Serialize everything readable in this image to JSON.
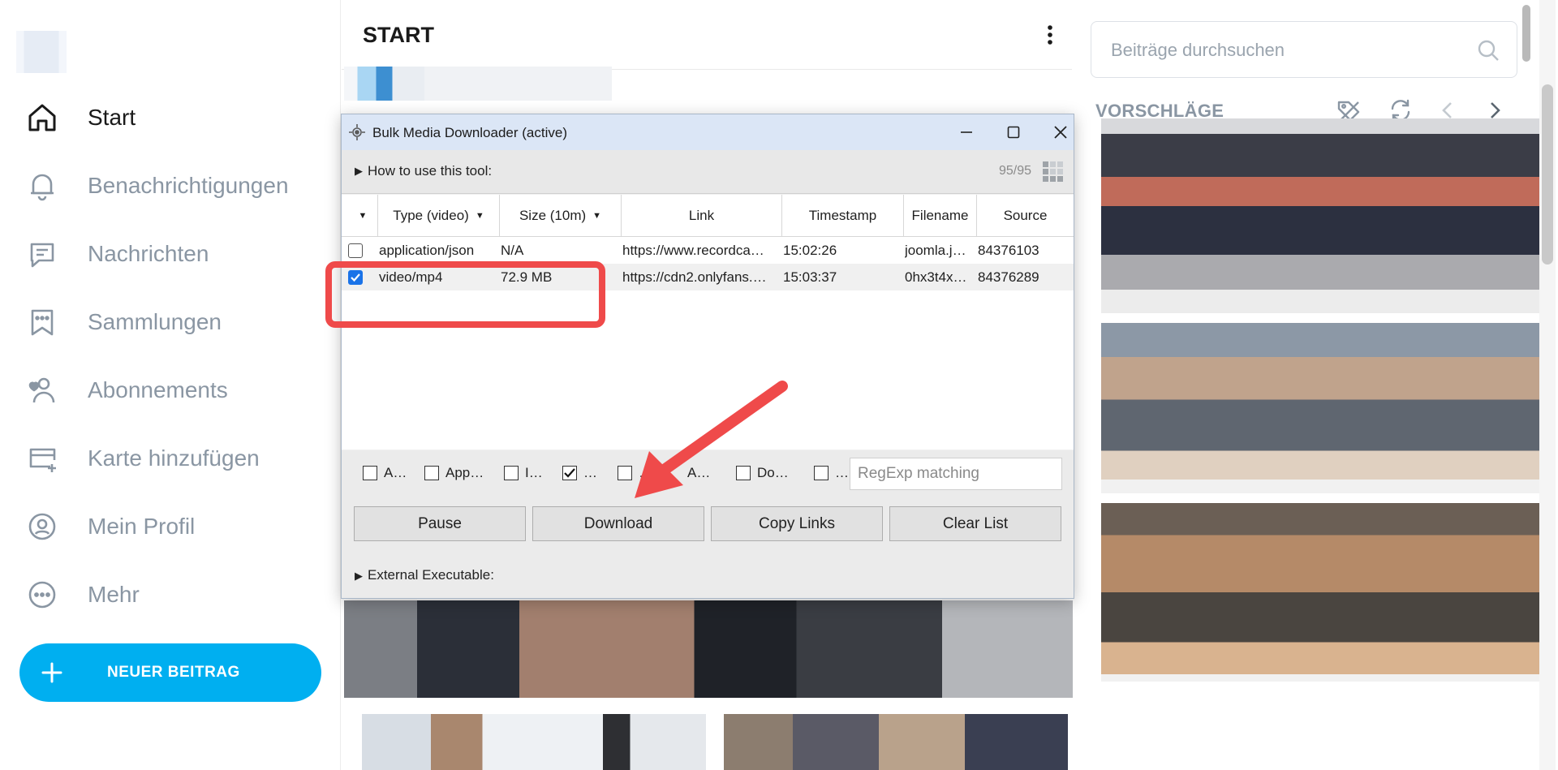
{
  "sidebar": {
    "items": [
      {
        "label": "Start",
        "icon": "home-icon",
        "active": true
      },
      {
        "label": "Benachrichtigungen",
        "icon": "bell-icon"
      },
      {
        "label": "Nachrichten",
        "icon": "message-icon"
      },
      {
        "label": "Sammlungen",
        "icon": "bookmark-stars-icon"
      },
      {
        "label": "Abonnements",
        "icon": "user-heart-icon"
      },
      {
        "label": "Karte hinzufügen",
        "icon": "card-plus-icon"
      },
      {
        "label": "Mein Profil",
        "icon": "profile-circle-icon"
      },
      {
        "label": "Mehr",
        "icon": "more-circle-icon"
      }
    ],
    "new_post": "NEUER BEITRAG"
  },
  "main": {
    "title": "START"
  },
  "right": {
    "search_placeholder": "Beiträge durchsuchen",
    "suggestions_title": "VORSCHLÄGE"
  },
  "extension": {
    "title": "Bulk Media Downloader (active)",
    "howto": "How to use this tool:",
    "count": "95/95",
    "columns": [
      "",
      "Type (video)",
      "Size (10m)",
      "Link",
      "Timestamp",
      "Filename",
      "Source"
    ],
    "rows": [
      {
        "checked": false,
        "type": "application/json",
        "size": "N/A",
        "link": "https://www.recordca…",
        "timestamp": "15:02:26",
        "filename": "joomla.j…",
        "source": "84376103"
      },
      {
        "checked": true,
        "type": "video/mp4",
        "size": "72.9 MB",
        "link": "https://cdn2.onlyfans.…",
        "timestamp": "15:03:37",
        "filename": "0hx3t4x…",
        "source": "84376289"
      }
    ],
    "filters": [
      {
        "label": "A…",
        "checked": false
      },
      {
        "label": "App…",
        "checked": false
      },
      {
        "label": "I…",
        "checked": false
      },
      {
        "label": "…",
        "checked": true
      },
      {
        "label": "…",
        "checked": false
      },
      {
        "label": "A…",
        "checked": false
      },
      {
        "label": "Do…",
        "checked": false
      },
      {
        "label": "…",
        "checked": false
      }
    ],
    "regex_placeholder": "RegExp matching",
    "buttons": [
      "Pause",
      "Download",
      "Copy Links",
      "Clear List"
    ],
    "external": "External Executable:"
  },
  "colors": {
    "accent": "#00aff0",
    "annotation_red": "#ef4a4a",
    "titlebar": "#dbe6f6"
  }
}
